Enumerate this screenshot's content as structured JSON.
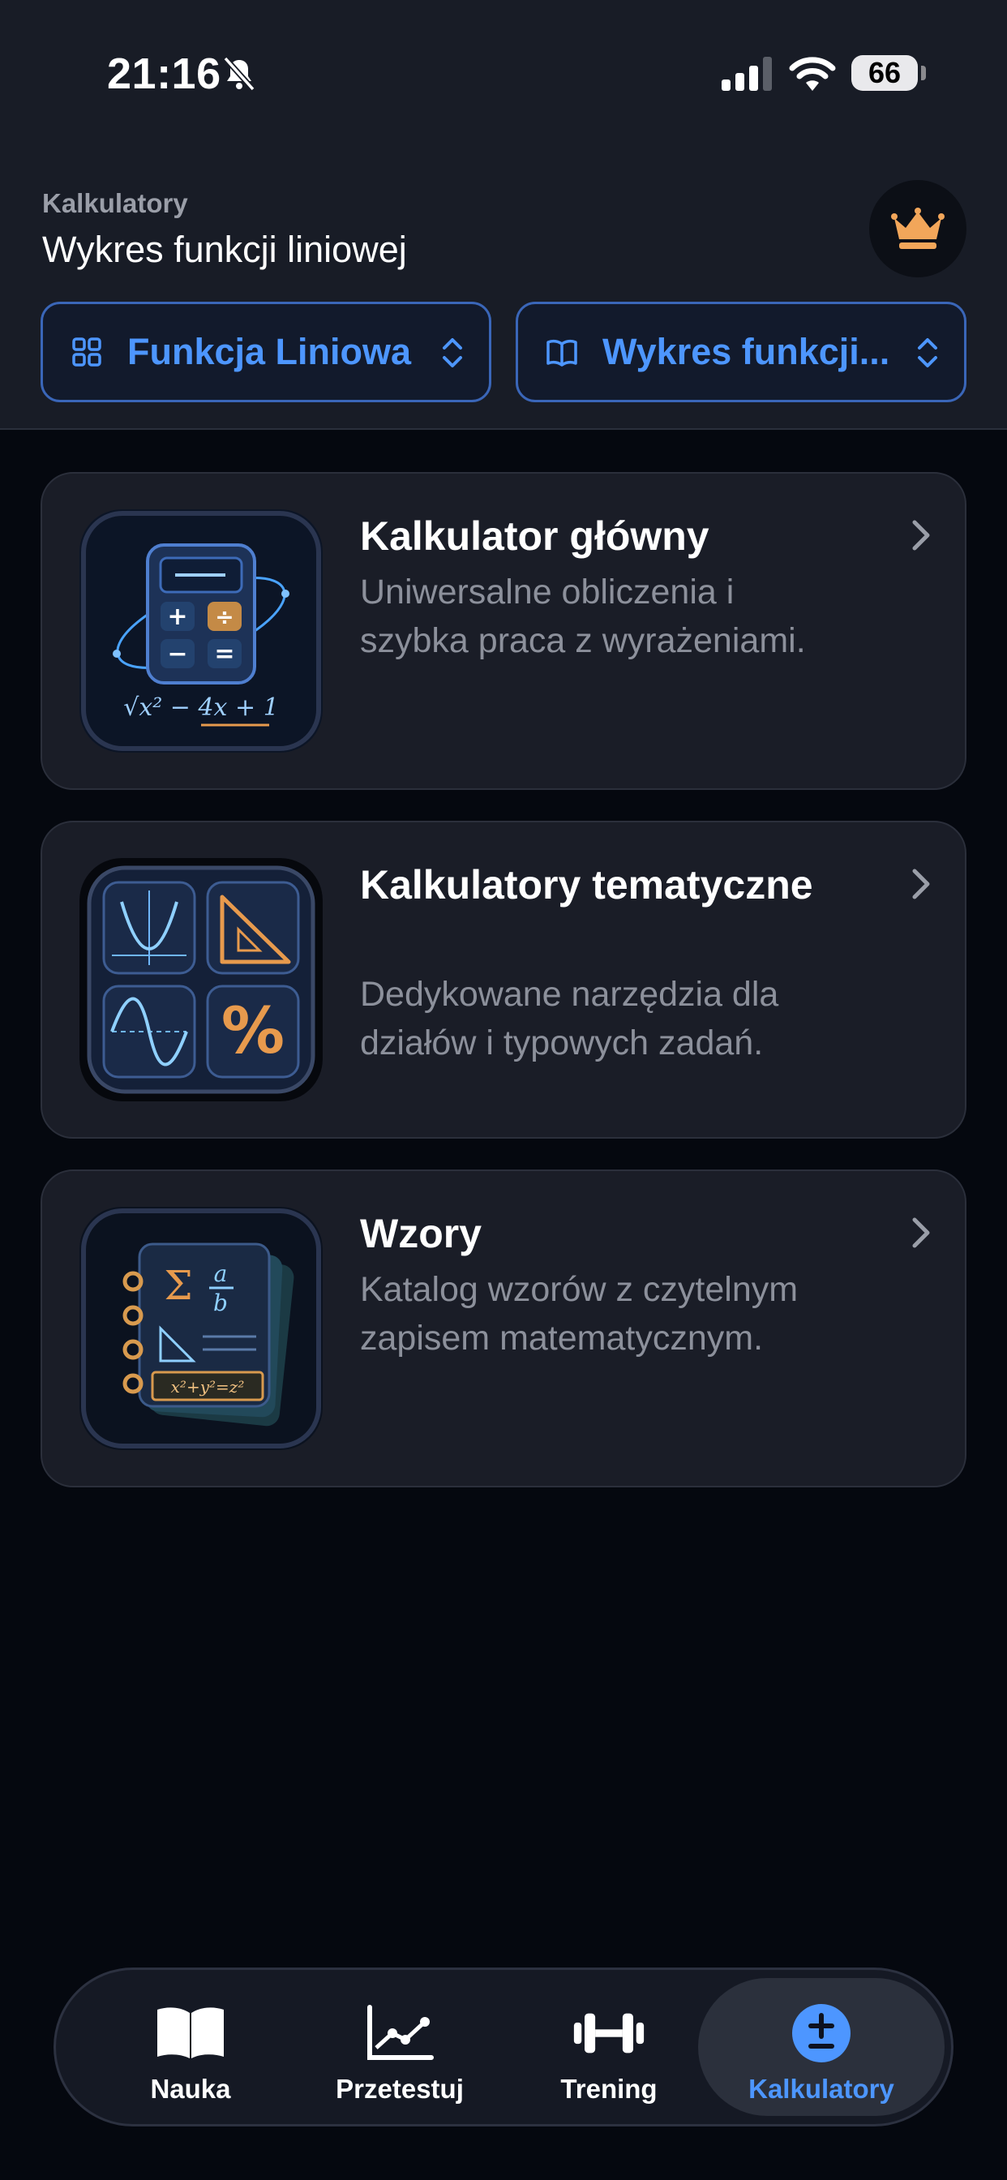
{
  "status_bar": {
    "time": "21:16",
    "battery": "66",
    "icons": [
      "bell-slash-icon",
      "cellular-signal-icon",
      "wifi-icon",
      "battery-icon"
    ]
  },
  "header": {
    "breadcrumb": "Kalkulatory",
    "title": "Wykres funkcji liniowej",
    "premium_icon": "crown-icon",
    "accent_color": "#f2a65a"
  },
  "pickers": [
    {
      "label": "Funkcja Liniowa",
      "icon": "grid-icon"
    },
    {
      "label": "Wykres funkcji...",
      "icon": "book-icon"
    }
  ],
  "cards": [
    {
      "title": "Kalkulator główny",
      "description": "Uniwersalne obliczenia i szybka praca z wyrażeniami.",
      "icon": "calculator-icon",
      "formula": "√x² − 4x + 1"
    },
    {
      "title": "Kalkulatory tematyczne",
      "description": "Dedykowane narzędzia dla działów i typowych zadań.",
      "icon": "topic-tools-icon",
      "symbol": "%"
    },
    {
      "title": "Wzory",
      "description": "Katalog wzorów z czytelnym zapisem matematycznym.",
      "icon": "formula-book-icon",
      "sigma": "Σ",
      "fraction_num": "a",
      "fraction_den": "b",
      "formula": "x²+y²=z²"
    }
  ],
  "tabbar": {
    "tabs": [
      {
        "label": "Nauka",
        "icon": "book-open-icon",
        "active": false
      },
      {
        "label": "Przetestuj",
        "icon": "chart-line-icon",
        "active": false
      },
      {
        "label": "Trening",
        "icon": "dumbbell-icon",
        "active": false
      },
      {
        "label": "Kalkulatory",
        "icon": "plus-minus-icon",
        "active": true
      }
    ],
    "active_color": "#4d96ff"
  }
}
